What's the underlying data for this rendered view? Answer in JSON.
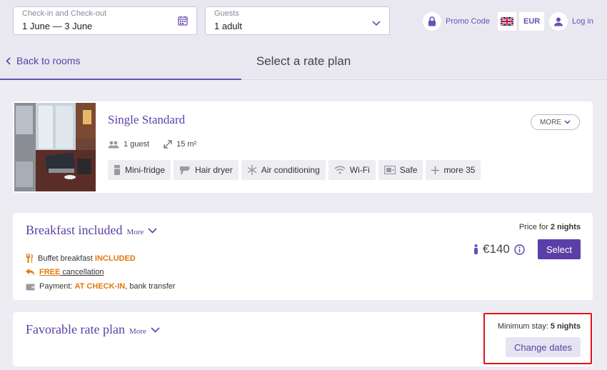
{
  "search": {
    "dates_label": "Check-in and Check-out",
    "dates_value": "1 June — 3 June",
    "guests_label": "Guests",
    "guests_value": "1 adult"
  },
  "header": {
    "promo": "Promo Code",
    "currency": "EUR",
    "login": "Log in"
  },
  "nav": {
    "back": "Back to rooms",
    "title": "Select a rate plan"
  },
  "room": {
    "name": "Single Standard",
    "more": "MORE",
    "guests": "1 guest",
    "area": "15 m²",
    "amenities": [
      "Mini-fridge",
      "Hair dryer",
      "Air conditioning",
      "Wi-Fi",
      "Safe",
      "more 35"
    ]
  },
  "rates": [
    {
      "name": "Breakfast included",
      "more": "More",
      "breakfast_text": "Buffet breakfast ",
      "breakfast_status": "INCLUDED",
      "cancel_free": "FREE",
      "cancel_text": " cancellation",
      "payment_text": "Payment: ",
      "payment_when": "AT CHECK-IN",
      "payment_rest": ", bank transfer",
      "price_for": "Price for ",
      "nights": "2 nights",
      "price": "€140",
      "select": "Select"
    },
    {
      "name": "Favorable rate plan",
      "more": "More",
      "min_stay_label": "Minimum stay: ",
      "min_stay_value": "5 nights",
      "change_dates": "Change dates"
    }
  ],
  "colors": {
    "accent": "#5b3fa6",
    "orange": "#e07a10",
    "highlight": "#e0121c"
  }
}
